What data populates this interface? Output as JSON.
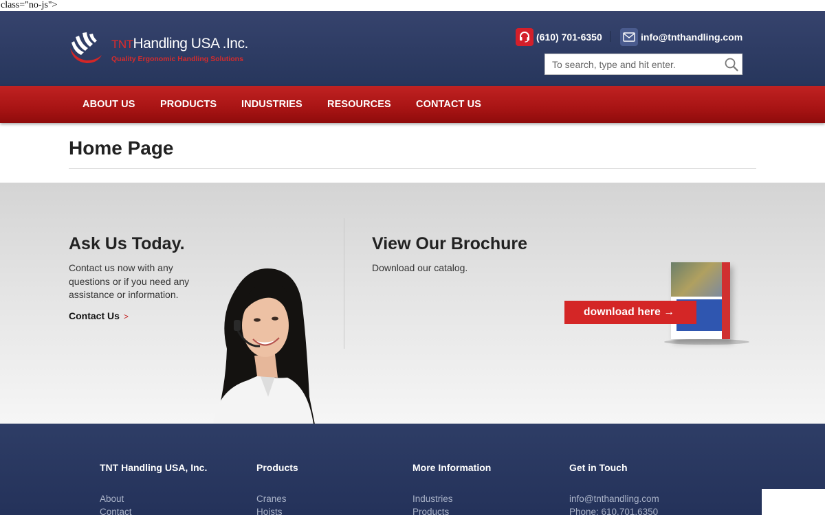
{
  "stray_text": "class=\"no-js\">",
  "brand": {
    "logo_prefix": "TNT",
    "logo_name": "Handling USA .Inc.",
    "tagline": "Quality Ergonomic Handling Solutions"
  },
  "header": {
    "phone": "(610) 701-6350",
    "email": "info@tnthandling.com",
    "search_placeholder": "To search, type and hit enter."
  },
  "nav": {
    "items": [
      "ABOUT US",
      "PRODUCTS",
      "INDUSTRIES",
      "RESOURCES",
      "CONTACT US"
    ]
  },
  "page": {
    "title": "Home Page"
  },
  "ask": {
    "heading": "Ask Us Today.",
    "body_line1": "Contact us now with any",
    "body_line2": "questions or if you need any",
    "body_line3": "assistance or information.",
    "link_label": "Contact Us",
    "link_arrow": ">"
  },
  "brochure": {
    "heading": "View Our Brochure",
    "body": "Download our catalog.",
    "button_label": "download here →"
  },
  "footer": {
    "col1": {
      "heading": "TNT Handling USA, Inc.",
      "links": [
        "About",
        "Contact"
      ]
    },
    "col2": {
      "heading": "Products",
      "links": [
        "Cranes",
        "Hoists"
      ]
    },
    "col3": {
      "heading": "More Information",
      "links": [
        "Industries",
        "Products"
      ]
    },
    "col4": {
      "heading": "Get in Touch",
      "links": [
        "info@tnthandling.com",
        "Phone: 610.701.6350"
      ]
    }
  },
  "colors": {
    "header_bg": "#2f3c64",
    "nav_red": "#b01919",
    "accent_red": "#d42626",
    "footer_bg": "#2a3860"
  },
  "icons": {
    "phone": "headset-icon",
    "email": "envelope-icon",
    "search": "magnifier-icon",
    "logo": "tnt-logo-mark"
  }
}
